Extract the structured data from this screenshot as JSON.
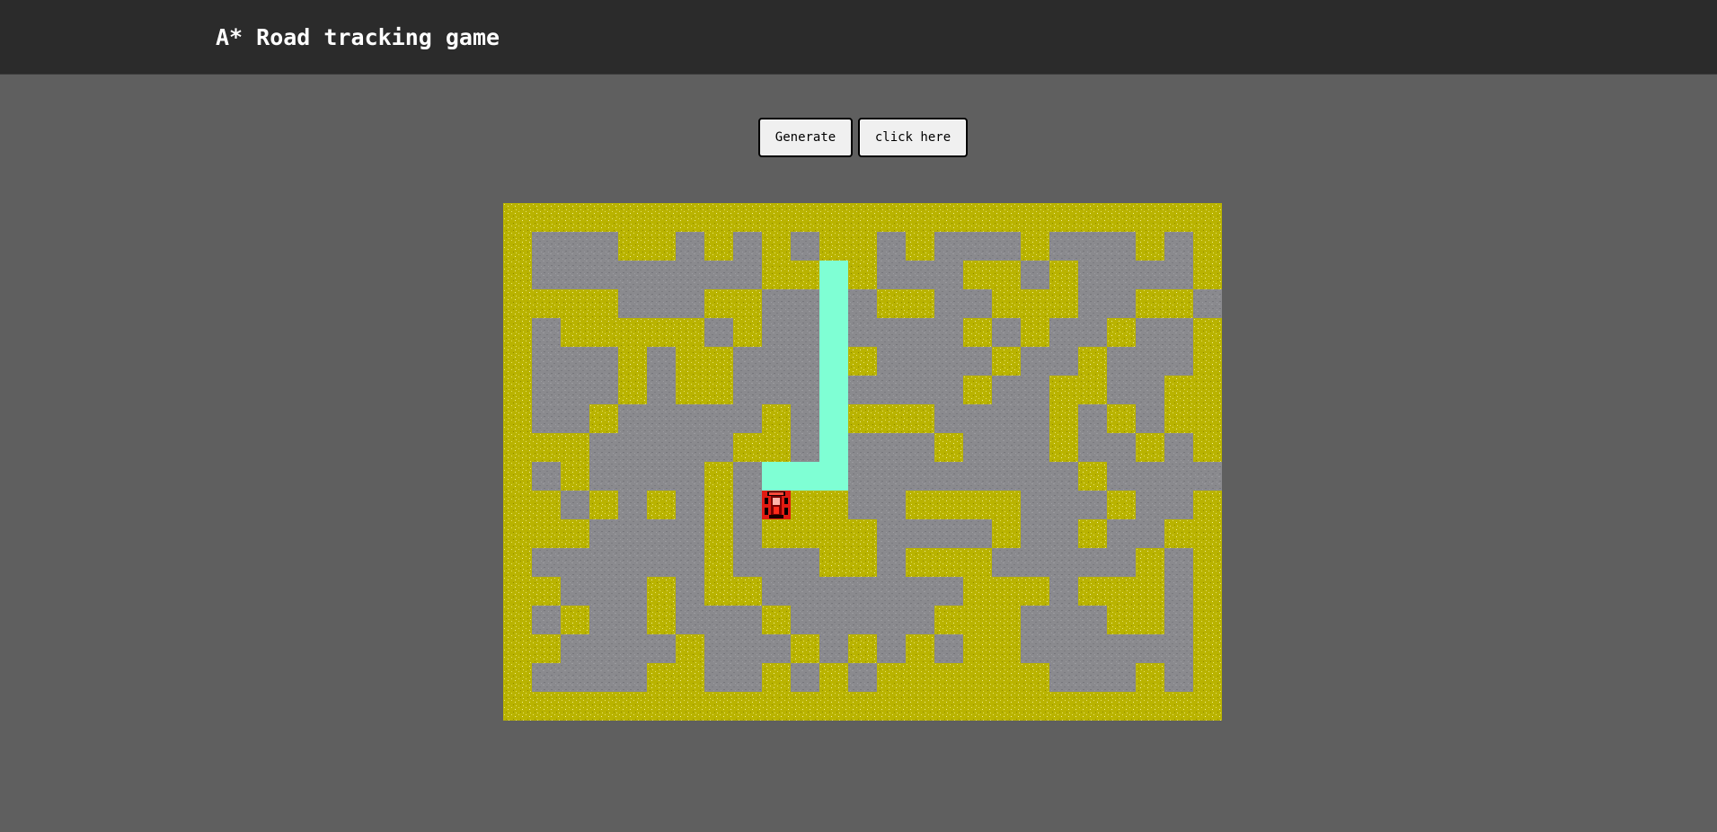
{
  "header": {
    "title": "A* Road tracking game"
  },
  "controls": {
    "generate_label": "Generate",
    "click_label": "click here"
  },
  "grid": {
    "cols": 25,
    "rows": 18,
    "colors": {
      "wall": "#b9b300",
      "road": "#8a8a8e",
      "path": "#7fffd4",
      "car": "#e01b12"
    },
    "map": [
      "YYYYYYYYYYYYYYYYYYYYYYYYY",
      "YGGGYYGYGYGYYGYGGGYGGGYGY",
      "YGGGGGGGGYYPYGGGYYGYGGGGY",
      "YYYYGGGYYGGPGYYGGYYYGGYYG",
      "YGYYYYYGYGGPGGGGYGYGGYGGY",
      "YGGGYGYYGGGPYGGGGYGGYGGGY",
      "YGGGYGYYGGGPGGGGYGGYYGGYY",
      "YGGYGGGGGYGPYYYGGGGYGYGYY",
      "YYYGGGGGYYGPGGGYGGGYGGYGY",
      "YGYGGGGYGPPPGGGGGGGGYGGGG",
      "YYGYGYGYGCYYGGYYYYGGGYGGY",
      "YYYGGGGYGYYYYGGGGYGGYGGYY",
      "YGGGGGGYGGGYYGYYYGGGGGYGY",
      "YYGGGYGYYGGGGGGGYYYGYYYGY",
      "YGYGGYGGGYGGGGGYYYGGGYYGY",
      "YYGGGGYGGGYGYGYGYYGGGGGGY",
      "YGGGGYYGGYGYGYYYYYYGGGYGY",
      "YYYYYYYYYYYYYYYYYYYYYYYYY"
    ]
  }
}
